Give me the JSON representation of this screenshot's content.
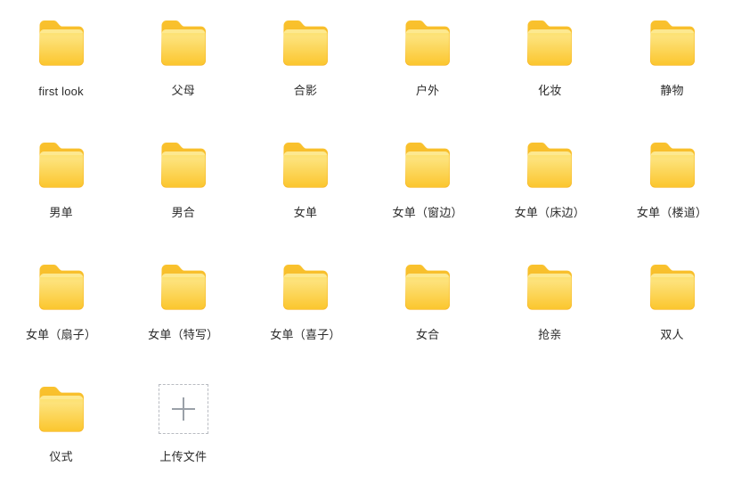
{
  "page": {
    "background_color": "#ffffff",
    "label_color": "#2b2b2b",
    "folder_colors": {
      "back_top": "#F9C22E",
      "back_bottom": "#F6B221",
      "front_top": "#FDE06A",
      "front_bottom": "#FBC62E",
      "front_highlight": "#FDE27A"
    },
    "upload_colors": {
      "border": "#b9bcc2",
      "plus": "#9aa0a8"
    }
  },
  "grid": {
    "columns": 6,
    "rows": 4,
    "items": [
      {
        "type": "folder",
        "icon": "folder-icon",
        "label": "first look"
      },
      {
        "type": "folder",
        "icon": "folder-icon",
        "label": "父母"
      },
      {
        "type": "folder",
        "icon": "folder-icon",
        "label": "合影"
      },
      {
        "type": "folder",
        "icon": "folder-icon",
        "label": "户外"
      },
      {
        "type": "folder",
        "icon": "folder-icon",
        "label": "化妆"
      },
      {
        "type": "folder",
        "icon": "folder-icon",
        "label": "静物"
      },
      {
        "type": "folder",
        "icon": "folder-icon",
        "label": "男单"
      },
      {
        "type": "folder",
        "icon": "folder-icon",
        "label": "男合"
      },
      {
        "type": "folder",
        "icon": "folder-icon",
        "label": "女单"
      },
      {
        "type": "folder",
        "icon": "folder-icon",
        "label": "女单（窗边）"
      },
      {
        "type": "folder",
        "icon": "folder-icon",
        "label": "女单（床边）"
      },
      {
        "type": "folder",
        "icon": "folder-icon",
        "label": "女单（楼道）"
      },
      {
        "type": "folder",
        "icon": "folder-icon",
        "label": "女单（扇子）"
      },
      {
        "type": "folder",
        "icon": "folder-icon",
        "label": "女单（特写）"
      },
      {
        "type": "folder",
        "icon": "folder-icon",
        "label": "女单（喜子）"
      },
      {
        "type": "folder",
        "icon": "folder-icon",
        "label": "女合"
      },
      {
        "type": "folder",
        "icon": "folder-icon",
        "label": "抢亲"
      },
      {
        "type": "folder",
        "icon": "folder-icon",
        "label": "双人"
      },
      {
        "type": "folder",
        "icon": "folder-icon",
        "label": "仪式"
      },
      {
        "type": "upload",
        "icon": "plus-icon",
        "label": "上传文件"
      }
    ]
  }
}
